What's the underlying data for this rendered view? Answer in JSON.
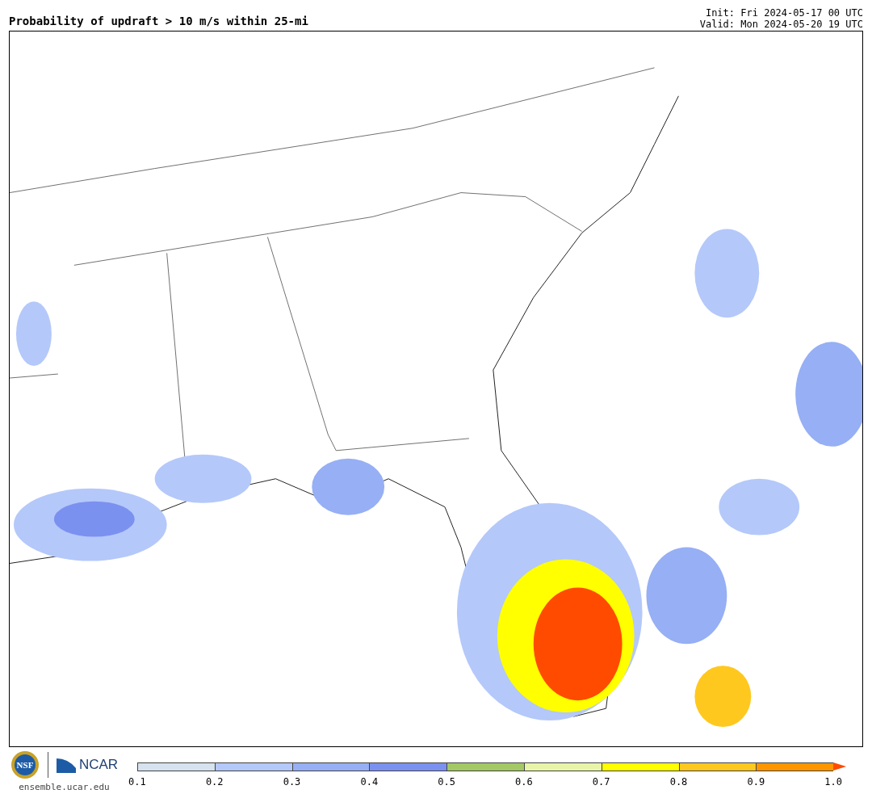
{
  "title": "Probability of updraft > 10 m/s within 25-mi",
  "init": "Init: Fri 2024-05-17 00 UTC",
  "valid": "Valid: Mon 2024-05-20 19 UTC",
  "logos": {
    "nsf": "NSF",
    "ncar": "NCAR",
    "website": "ensemble.ucar.edu"
  },
  "colorbar": {
    "segments": [
      {
        "kind": "box",
        "color": "#d6e2ee"
      },
      {
        "kind": "box",
        "color": "#b4c8fa"
      },
      {
        "kind": "box",
        "color": "#96aff5"
      },
      {
        "kind": "box",
        "color": "#7b91f0"
      },
      {
        "kind": "box",
        "color": "#a4c865"
      },
      {
        "kind": "box",
        "color": "#e8f5a8"
      },
      {
        "kind": "box",
        "color": "#ffff00"
      },
      {
        "kind": "box",
        "color": "#ffc81e"
      },
      {
        "kind": "box",
        "color": "#ff9600"
      },
      {
        "kind": "arrow",
        "color": "#ff4b00"
      }
    ],
    "ticks": [
      "0.1",
      "0.2",
      "0.3",
      "0.4",
      "0.5",
      "0.6",
      "0.7",
      "0.8",
      "0.9",
      "1.0"
    ]
  }
}
